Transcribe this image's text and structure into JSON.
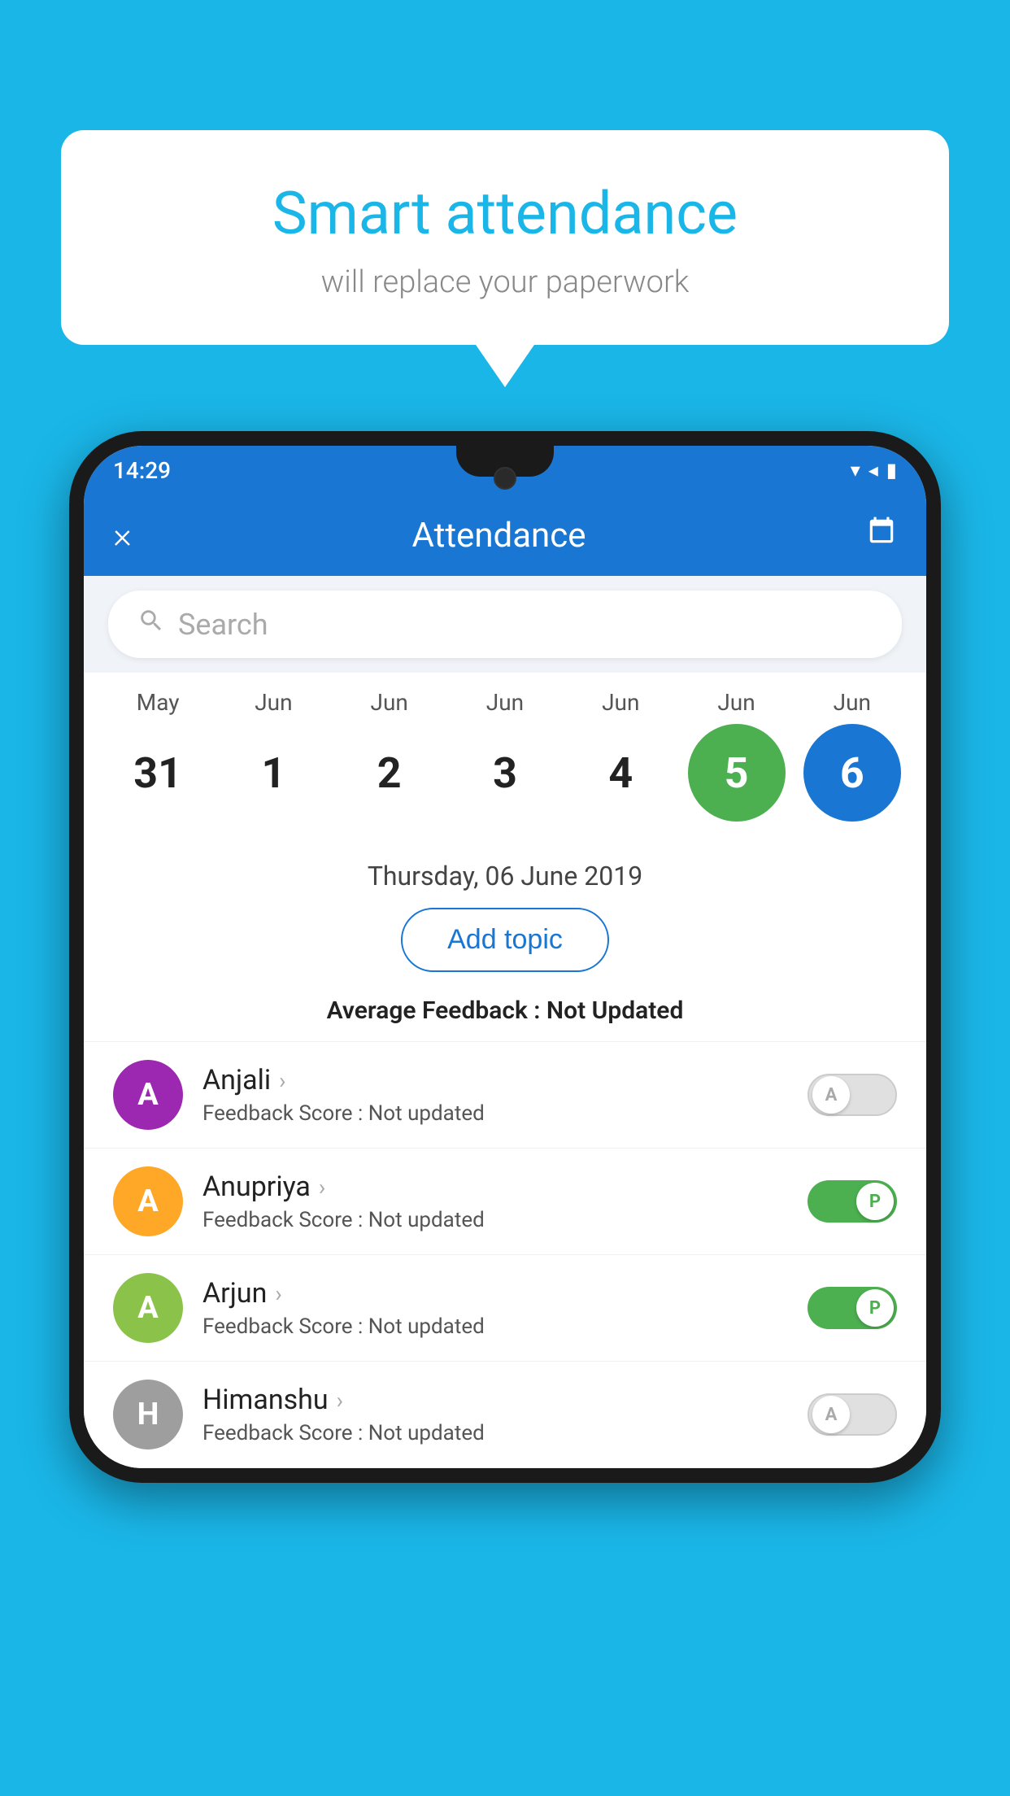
{
  "background_color": "#1ab6e8",
  "speech_bubble": {
    "title": "Smart attendance",
    "subtitle": "will replace your paperwork"
  },
  "status_bar": {
    "time": "14:29",
    "wifi_icon": "▼",
    "signal_icon": "▲",
    "battery_icon": "▮"
  },
  "header": {
    "title": "Attendance",
    "close_label": "×",
    "calendar_label": "📅"
  },
  "search": {
    "placeholder": "Search"
  },
  "calendar": {
    "months": [
      "May",
      "Jun",
      "Jun",
      "Jun",
      "Jun",
      "Jun",
      "Jun"
    ],
    "dates": [
      "31",
      "1",
      "2",
      "3",
      "4",
      "5",
      "6"
    ],
    "active_green_index": 5,
    "active_blue_index": 6
  },
  "selected_date": "Thursday, 06 June 2019",
  "add_topic_label": "Add topic",
  "average_feedback": {
    "label": "Average Feedback : ",
    "value": "Not Updated"
  },
  "students": [
    {
      "name": "Anjali",
      "avatar_letter": "A",
      "avatar_color": "#9c27b0",
      "feedback_label": "Feedback Score : ",
      "feedback_value": "Not updated",
      "toggle_state": "off",
      "toggle_label": "A"
    },
    {
      "name": "Anupriya",
      "avatar_letter": "A",
      "avatar_color": "#ffa726",
      "feedback_label": "Feedback Score : ",
      "feedback_value": "Not updated",
      "toggle_state": "on",
      "toggle_label": "P"
    },
    {
      "name": "Arjun",
      "avatar_letter": "A",
      "avatar_color": "#8bc34a",
      "feedback_label": "Feedback Score : ",
      "feedback_value": "Not updated",
      "toggle_state": "on",
      "toggle_label": "P"
    },
    {
      "name": "Himanshu",
      "avatar_letter": "H",
      "avatar_color": "#9e9e9e",
      "feedback_label": "Feedback Score : ",
      "feedback_value": "Not updated",
      "toggle_state": "off",
      "toggle_label": "A"
    }
  ]
}
